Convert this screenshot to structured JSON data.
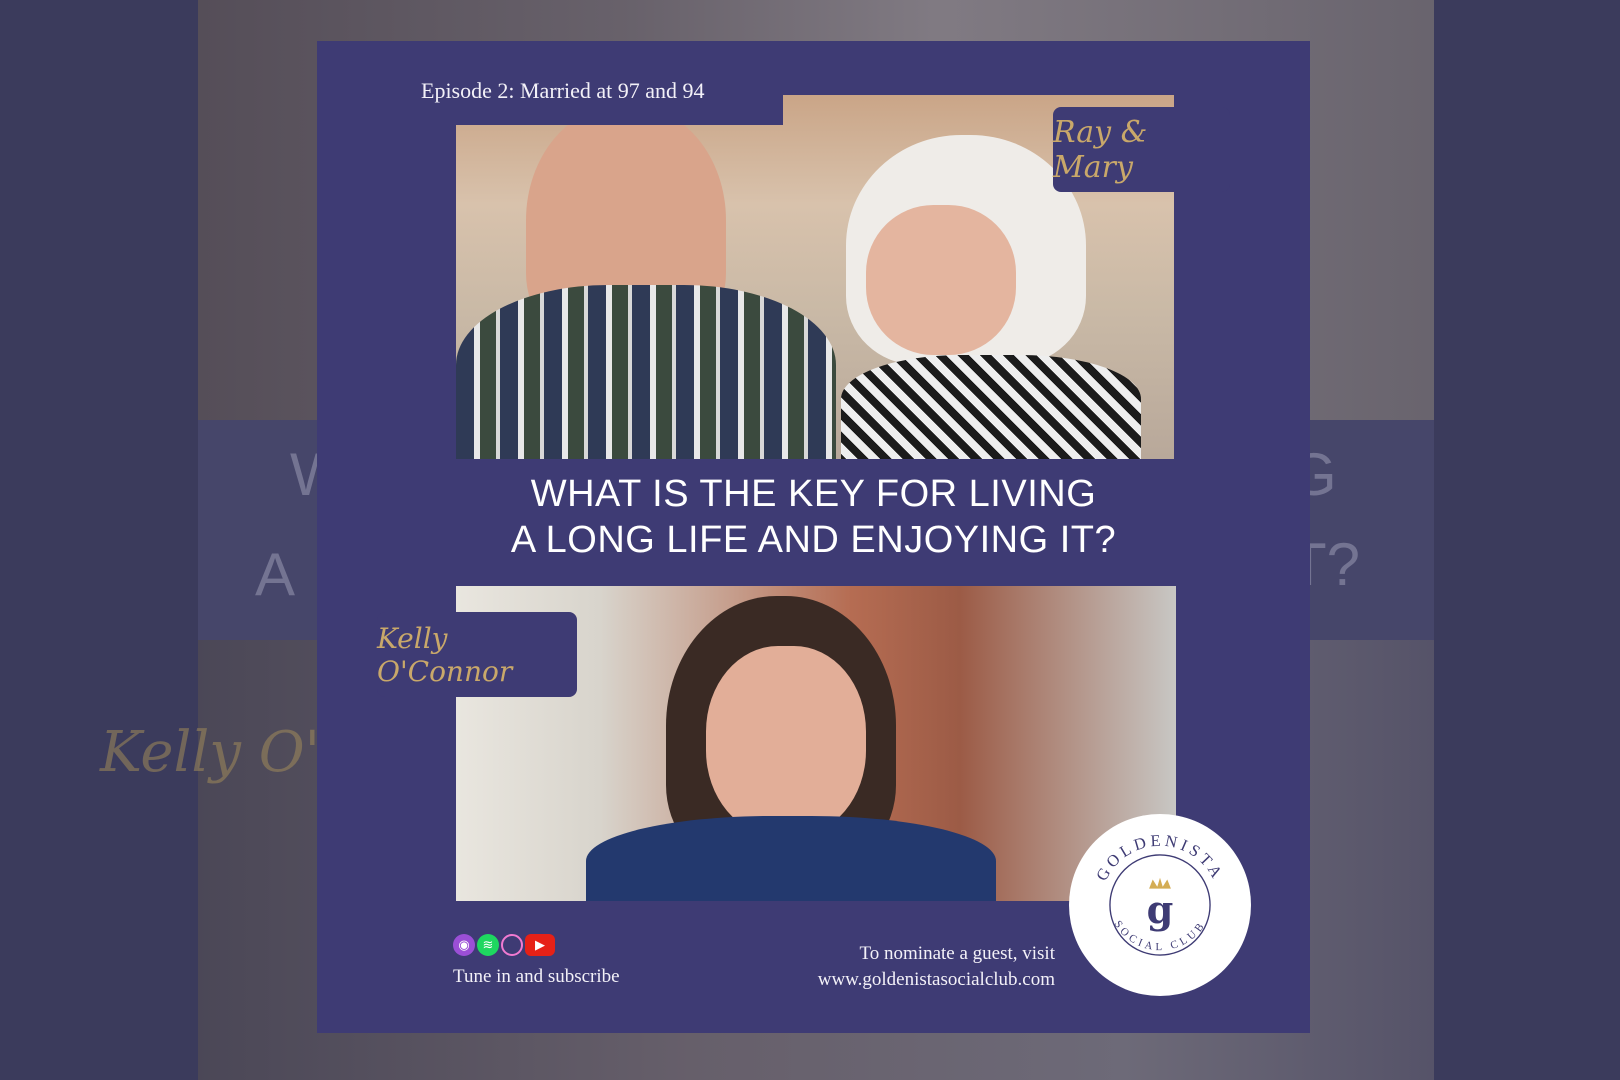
{
  "episode_label": "Episode 2: Married at 97 and 94",
  "guests_tag": "Ray & Mary",
  "host_tag": "Kelly O'Connor",
  "headline_line1": "WHAT IS THE KEY FOR LIVING",
  "headline_line2": "A LONG LIFE AND ENJOYING IT?",
  "tune_in": "Tune in and subscribe",
  "nominate_line1": "To nominate a guest, visit",
  "nominate_line2": "www.goldenistasocialclub.com",
  "logo": {
    "top_text": "GOLDENISTA",
    "bottom_text": "SOCIAL CLUB",
    "monogram": "g"
  },
  "platform_icons": [
    "apple-podcasts-icon",
    "spotify-icon",
    "podcast-cast-icon",
    "youtube-icon"
  ],
  "backdrop": {
    "left_fragment1": "W",
    "left_fragment2": "A",
    "right_fragment1": "G",
    "right_fragment2": "T?",
    "script_fragment": "Kelly O'Co"
  },
  "colors": {
    "card": "#3e3b74",
    "gold": "#c9a86a",
    "text": "#ffffff"
  }
}
